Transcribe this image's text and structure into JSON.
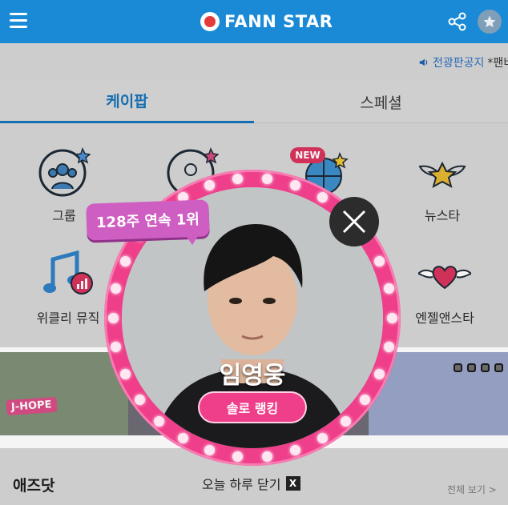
{
  "header": {
    "brand": "FANN STAR",
    "colors": {
      "bar": "#1a8ad6",
      "logo_red": "#e53b3b"
    }
  },
  "notice": {
    "link_text": "전광판공지",
    "text": "*팬비"
  },
  "tabs": [
    {
      "label": "케이팝",
      "active": true
    },
    {
      "label": "스페셜",
      "active": false
    }
  ],
  "grid": {
    "items": [
      {
        "label": "그룹",
        "icon": "group-icon"
      },
      {
        "label": "",
        "icon": "solo-icon"
      },
      {
        "label": "",
        "icon": "globe-icon",
        "badge": "NEW"
      },
      {
        "label": "뉴스타",
        "icon": "newstar-icon"
      },
      {
        "label": "위클리 뮤직",
        "icon": "weekly-music-icon"
      },
      {
        "label": "엔젤앤스타",
        "icon": "angel-heart-icon"
      }
    ]
  },
  "banner": {
    "left_tag": "J-HOPE"
  },
  "sections": {
    "ads_title": "애즈닷",
    "see_all": "전체 보기 >"
  },
  "popup": {
    "streak_badge": "128주 연속 1위",
    "artist_name": "임영웅",
    "rank_button": "솔로 랭킹",
    "today_close": "오늘 하루 닫기",
    "today_close_x": "X",
    "colors": {
      "ring": "#ef3f8a",
      "badge": "#cf5ec2"
    }
  }
}
